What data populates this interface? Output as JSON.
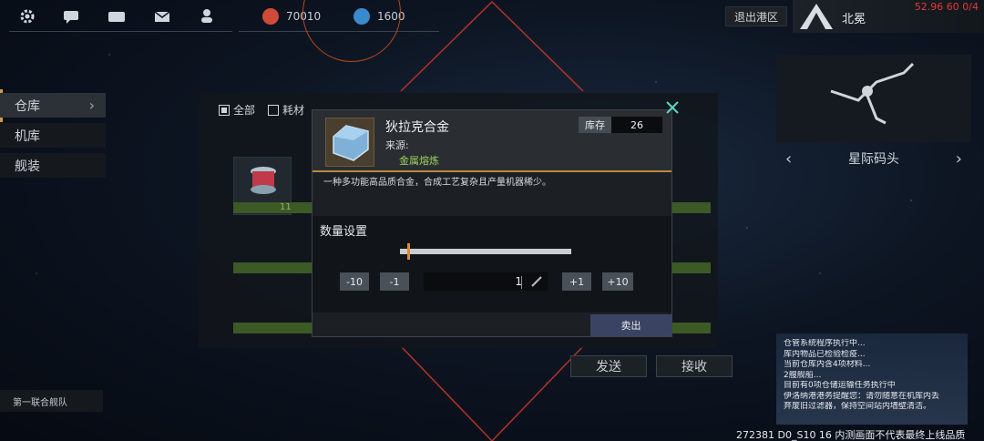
{
  "topbar": {
    "icons": [
      "gear-icon",
      "chat-icon",
      "keyboard-icon",
      "mail-icon",
      "user-icon"
    ],
    "resources": [
      {
        "icon": "fuel-icon",
        "value": "70010",
        "color": "#d04a3a"
      },
      {
        "icon": "credit-icon",
        "value": "1600",
        "color": "#3a8ad0"
      }
    ],
    "exit_label": "退出港区",
    "faction_name": "北冕",
    "fps_readout": "52.96 60 0/4"
  },
  "leftnav": {
    "items": [
      {
        "label": "仓库",
        "active": true
      },
      {
        "label": "机库",
        "active": false
      },
      {
        "label": "舰装",
        "active": false
      }
    ],
    "fleet_label": "第一联合舰队"
  },
  "inventory": {
    "filters": [
      {
        "label": "全部",
        "checked": true
      },
      {
        "label": "耗材",
        "checked": false
      }
    ],
    "first_item_count": "11",
    "send_label": "发送",
    "receive_label": "接收"
  },
  "right_panel": {
    "location_label": "星际码头",
    "log_lines": [
      "仓管系统程序执行中...",
      "库内物品已检验检疫...",
      "当前仓库内含4项材料...",
      "2艘舰船...",
      "目前有0项仓储运输任务执行中",
      "伊洛纳港港务提醒您：请勿随意在机库内丢",
      "弃废旧过滤器，保持空间站内墙壁清洁。"
    ]
  },
  "build_info": "272381 D0_S10 16  内测画面不代表最终上线品质",
  "dialog": {
    "item_name": "狄拉克合金",
    "source_label": "来源:",
    "source_value": "金属熔炼",
    "stock_label": "库存",
    "stock_value": "26",
    "description": "一种多功能高品质合金，合成工艺复杂且产量机器稀少。",
    "quantity_title": "数量设置",
    "quantity_value": "1",
    "quantity_fraction": 0.04,
    "minus10_label": "-10",
    "minus1_label": "-1",
    "plus1_label": "+1",
    "plus10_label": "+10",
    "sell_label": "卖出",
    "accent_color": "#b88a3c"
  }
}
